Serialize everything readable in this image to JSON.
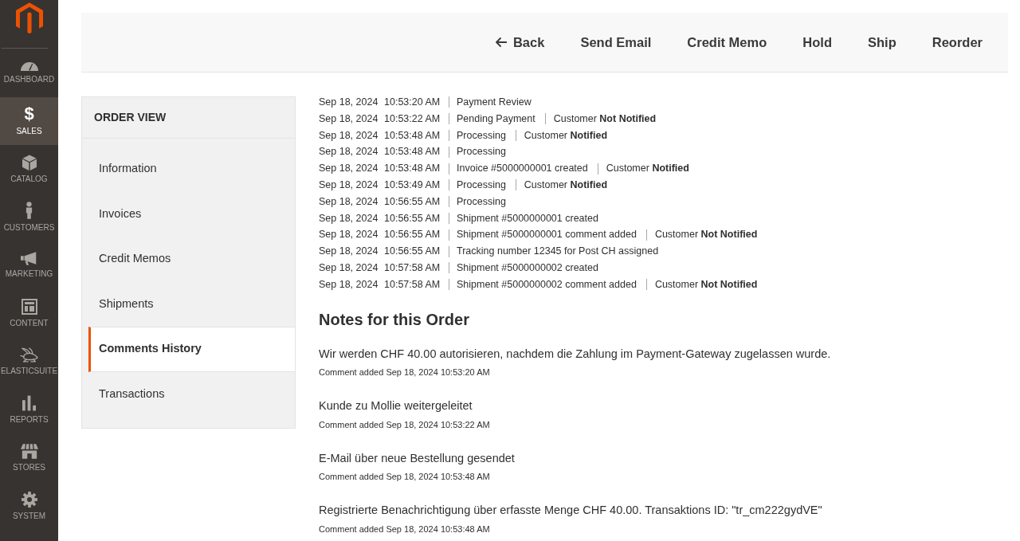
{
  "sidebar": {
    "items": [
      {
        "label": "DASHBOARD",
        "selected": false
      },
      {
        "label": "SALES",
        "glyph": "$",
        "selected": true
      },
      {
        "label": "CATALOG",
        "selected": false
      },
      {
        "label": "CUSTOMERS",
        "selected": false
      },
      {
        "label": "MARKETING",
        "selected": false
      },
      {
        "label": "CONTENT",
        "selected": false
      },
      {
        "label": "ELASTICSUITE",
        "selected": false
      },
      {
        "label": "REPORTS",
        "selected": false
      },
      {
        "label": "STORES",
        "selected": false
      },
      {
        "label": "SYSTEM",
        "selected": false
      }
    ]
  },
  "page_actions": [
    {
      "kind": "back",
      "label": "Back"
    },
    {
      "kind": "action",
      "label": "Send Email"
    },
    {
      "kind": "action",
      "label": "Credit Memo"
    },
    {
      "kind": "action",
      "label": "Hold"
    },
    {
      "kind": "action",
      "label": "Ship"
    },
    {
      "kind": "action",
      "label": "Reorder"
    }
  ],
  "order_view": {
    "title": "ORDER VIEW",
    "tabs": [
      {
        "label": "Information",
        "selected": false
      },
      {
        "label": "Invoices",
        "selected": false
      },
      {
        "label": "Credit Memos",
        "selected": false
      },
      {
        "label": "Shipments",
        "selected": false
      },
      {
        "label": "Comments History",
        "selected": true
      },
      {
        "label": "Transactions",
        "selected": false
      }
    ]
  },
  "history": [
    {
      "date": "Sep 18, 2024",
      "time": "10:53:20 AM",
      "comment": "Payment Review"
    },
    {
      "date": "Sep 18, 2024",
      "time": "10:53:22 AM",
      "comment": "Pending Payment",
      "notification": "Customer **Not Notified**"
    },
    {
      "date": "Sep 18, 2024",
      "time": "10:53:48 AM",
      "comment": "Processing",
      "notification": "Customer **Notified**"
    },
    {
      "date": "Sep 18, 2024",
      "time": "10:53:48 AM",
      "comment": "Processing"
    },
    {
      "date": "Sep 18, 2024",
      "time": "10:53:48 AM",
      "comment": "Invoice #5000000001 created",
      "notification": "Customer **Notified**"
    },
    {
      "date": "Sep 18, 2024",
      "time": "10:53:49 AM",
      "comment": "Processing",
      "notification": "Customer **Notified**"
    },
    {
      "date": "Sep 18, 2024",
      "time": "10:56:55 AM",
      "comment": "Processing"
    },
    {
      "date": "Sep 18, 2024",
      "time": "10:56:55 AM",
      "comment": "Shipment #5000000001 created"
    },
    {
      "date": "Sep 18, 2024",
      "time": "10:56:55 AM",
      "comment": "Shipment #5000000001 comment added",
      "notification": "Customer **Not Notified**"
    },
    {
      "date": "Sep 18, 2024",
      "time": "10:56:55 AM",
      "comment": "Tracking number 12345 for Post CH assigned"
    },
    {
      "date": "Sep 18, 2024",
      "time": "10:57:58 AM",
      "comment": "Shipment #5000000002 created"
    },
    {
      "date": "Sep 18, 2024",
      "time": "10:57:58 AM",
      "comment": "Shipment #5000000002 comment added",
      "notification": "Customer **Not Notified**"
    }
  ],
  "notes": {
    "title": "Notes for this Order",
    "items": [
      {
        "text": "Wir werden CHF 40.00 autorisieren, nachdem die Zahlung im Payment-Gateway zugelassen wurde.",
        "meta": "Comment added Sep 18, 2024 10:53:20 AM"
      },
      {
        "text": "Kunde zu Mollie weitergeleitet",
        "meta": "Comment added Sep 18, 2024 10:53:22 AM"
      },
      {
        "text": "E-Mail über neue Bestellung gesendet",
        "meta": "Comment added Sep 18, 2024 10:53:48 AM"
      },
      {
        "text": "Registrierte Benachrichtigung über erfasste Menge CHF 40.00. Transaktions ID: \"tr_cm222gydVE\"",
        "meta": "Comment added Sep 18, 2024 10:53:48 AM"
      }
    ]
  }
}
